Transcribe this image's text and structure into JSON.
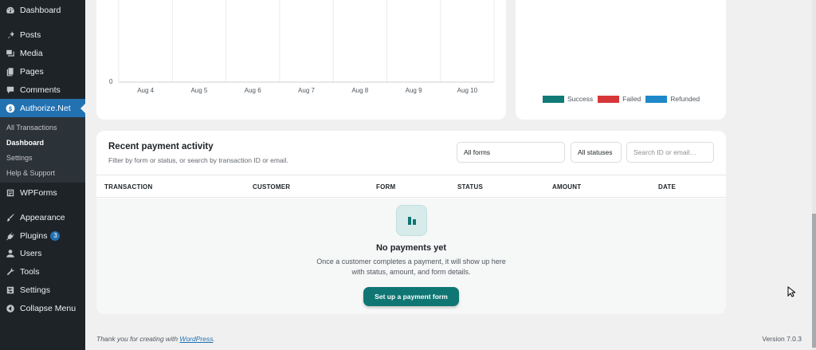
{
  "sidebar": {
    "items": [
      {
        "label": "Dashboard",
        "icon": "dashboard-icon"
      },
      {
        "label": "Posts",
        "icon": "pin-icon"
      },
      {
        "label": "Media",
        "icon": "media-icon"
      },
      {
        "label": "Pages",
        "icon": "pages-icon"
      },
      {
        "label": "Comments",
        "icon": "comments-icon"
      },
      {
        "label": "Authorize.Net",
        "icon": "dollar-icon",
        "active": true
      },
      {
        "label": "WPForms",
        "icon": "wpforms-icon"
      },
      {
        "label": "Appearance",
        "icon": "brush-icon"
      },
      {
        "label": "Plugins",
        "icon": "plugin-icon",
        "badge": "3"
      },
      {
        "label": "Users",
        "icon": "user-icon"
      },
      {
        "label": "Tools",
        "icon": "wrench-icon"
      },
      {
        "label": "Settings",
        "icon": "settings-icon"
      },
      {
        "label": "Collapse Menu",
        "icon": "collapse-icon"
      }
    ],
    "submenu": [
      {
        "label": "All Transactions"
      },
      {
        "label": "Dashboard",
        "current": true
      },
      {
        "label": "Settings"
      },
      {
        "label": "Help & Support"
      }
    ]
  },
  "chart_data": {
    "type": "line",
    "categories": [
      "Aug 4",
      "Aug 5",
      "Aug 6",
      "Aug 7",
      "Aug 8",
      "Aug 9",
      "Aug 10"
    ],
    "y_tick_labels": [
      "0"
    ],
    "grid": true
  },
  "legend": {
    "items": [
      {
        "label": "Success",
        "color": "#117a77"
      },
      {
        "label": "Failed",
        "color": "#d63638"
      },
      {
        "label": "Refunded",
        "color": "#1e88c9"
      }
    ]
  },
  "activity": {
    "title": "Recent payment activity",
    "subtitle": "Filter by form or status, or search by transaction ID or email.",
    "form_filter": "All forms",
    "status_filter": "All statuses",
    "search_placeholder": "Search ID or email…",
    "columns": [
      "TRANSACTION",
      "CUSTOMER",
      "FORM",
      "STATUS",
      "AMOUNT",
      "DATE"
    ],
    "empty": {
      "title": "No payments yet",
      "line1": "Once a customer completes a payment, it will show up here",
      "line2": "with status, amount, and form details.",
      "button": "Set up a payment form"
    }
  },
  "footer": {
    "thanks_prefix": "Thank you for creating with ",
    "thanks_link": "WordPress",
    "thanks_suffix": ".",
    "version": "Version 7.0.3"
  },
  "colors": {
    "accent": "#0f7673",
    "wp_blue": "#2271b1",
    "sidebar_bg": "#1d2327"
  }
}
